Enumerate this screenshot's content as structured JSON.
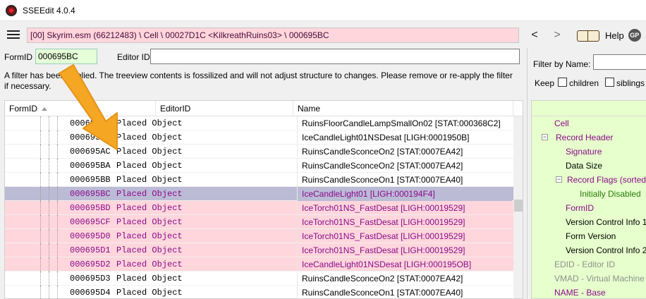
{
  "window": {
    "title": "SSEEdit 4.0.4"
  },
  "toolbar": {
    "path": "[00] Skyrim.esm (66212483) \\ Cell \\ 00027D1C <KilkreathRuins03> \\ 000695BC",
    "back_label": "<",
    "forward_label": ">",
    "help_label": "Help",
    "gp_label": "GP"
  },
  "search": {
    "formid_label": "FormID",
    "formid_value": "000695BC",
    "editorid_label": "Editor ID",
    "editorid_value": ""
  },
  "filter_message": "A filter has been applied. The treeview contents is fossilized and will not adjust structure to changes.  Please remove or re-apply the filter if necessary.",
  "grid": {
    "columns": [
      "FormID",
      "EditorID",
      "Name"
    ],
    "rows": [
      {
        "formid": "000695AA",
        "sig": "Placed Object",
        "name": "RuinsFloorCandleLampSmallOn02 [STAT:000368C2]",
        "style": "normal"
      },
      {
        "formid": "000695AB",
        "sig": "Placed Object",
        "name": "IceCandleLight01NSDesat [LIGH:0001950B]",
        "style": "normal"
      },
      {
        "formid": "000695AC",
        "sig": "Placed Object",
        "name": "RuinsCandleSconceOn2 [STAT:0007EA42]",
        "style": "normal"
      },
      {
        "formid": "000695BA",
        "sig": "Placed Object",
        "name": "RuinsCandleSconceOn2 [STAT:0007EA42]",
        "style": "normal"
      },
      {
        "formid": "000695BB",
        "sig": "Placed Object",
        "name": "RuinsCandleSconceOn1 [STAT:0007EA40]",
        "style": "normal"
      },
      {
        "formid": "000695BC",
        "sig": "Placed Object",
        "name": "IceCandleLight01 [LIGH:000194F4]",
        "style": "selected"
      },
      {
        "formid": "000695BD",
        "sig": "Placed Object",
        "name": "IceTorch01NS_FastDesat [LIGH:00019529]",
        "style": "pink"
      },
      {
        "formid": "000695CF",
        "sig": "Placed Object",
        "name": "IceTorch01NS_FastDesat [LIGH:00019529]",
        "style": "pink"
      },
      {
        "formid": "000695D0",
        "sig": "Placed Object",
        "name": "IceTorch01NS_FastDesat [LIGH:00019529]",
        "style": "pink"
      },
      {
        "formid": "000695D1",
        "sig": "Placed Object",
        "name": "IceTorch01NS_FastDesat [LIGH:00019529]",
        "style": "pink"
      },
      {
        "formid": "000695D2",
        "sig": "Placed Object",
        "name": "IceCandleLight01NSDesat [LIGH:000195OB]",
        "style": "pink"
      },
      {
        "formid": "000695D3",
        "sig": "Placed Object",
        "name": "RuinsCandleSconceOn2 [STAT:0007EA42]",
        "style": "normal"
      },
      {
        "formid": "000695D4",
        "sig": "Placed Object",
        "name": "RuinsCandleSconceOn1 [STAT:0007EA40]",
        "style": "normal"
      }
    ]
  },
  "right_panel": {
    "filter_label": "Filter by Name:",
    "keep_label": "Keep",
    "children_label": "children",
    "siblings_label": "siblings",
    "tree": [
      {
        "label": "Cell",
        "indent": 0,
        "color": "purple",
        "expander": "",
        "green": true
      },
      {
        "label": "Record Header",
        "indent": 0,
        "color": "purple",
        "expander": "−",
        "green": true
      },
      {
        "label": "Signature",
        "indent": 1,
        "color": "purple",
        "expander": "",
        "green": true
      },
      {
        "label": "Data Size",
        "indent": 1,
        "color": "dark",
        "expander": "",
        "green": true
      },
      {
        "label": "Record Flags (sorted)",
        "indent": 1,
        "color": "purple",
        "expander": "−",
        "green": true
      },
      {
        "label": "Initially Disabled",
        "indent": 2,
        "color": "green",
        "expander": "",
        "green": true
      },
      {
        "label": "FormID",
        "indent": 1,
        "color": "purple",
        "expander": "",
        "green": true
      },
      {
        "label": "Version Control Info 1",
        "indent": 1,
        "color": "dark",
        "expander": "",
        "green": true
      },
      {
        "label": "Form Version",
        "indent": 1,
        "color": "dark",
        "expander": "",
        "green": true
      },
      {
        "label": "Version Control Info 2",
        "indent": 1,
        "color": "dark",
        "expander": "",
        "green": true
      },
      {
        "label": "EDID - Editor ID",
        "indent": 0,
        "color": "gray",
        "expander": "",
        "green": true
      },
      {
        "label": "VMAD - Virtual Machine",
        "indent": 0,
        "color": "gray",
        "expander": "",
        "green": true
      },
      {
        "label": "NAME - Base",
        "indent": 0,
        "color": "purple",
        "expander": "",
        "green": true
      }
    ]
  },
  "colors": {
    "pink_row": "#ffd6dc",
    "selected_row": "#bbbbd6",
    "purple_text": "#8a0a8a",
    "green_panel": "#e6ffcc",
    "arrow": "#f5a623"
  }
}
